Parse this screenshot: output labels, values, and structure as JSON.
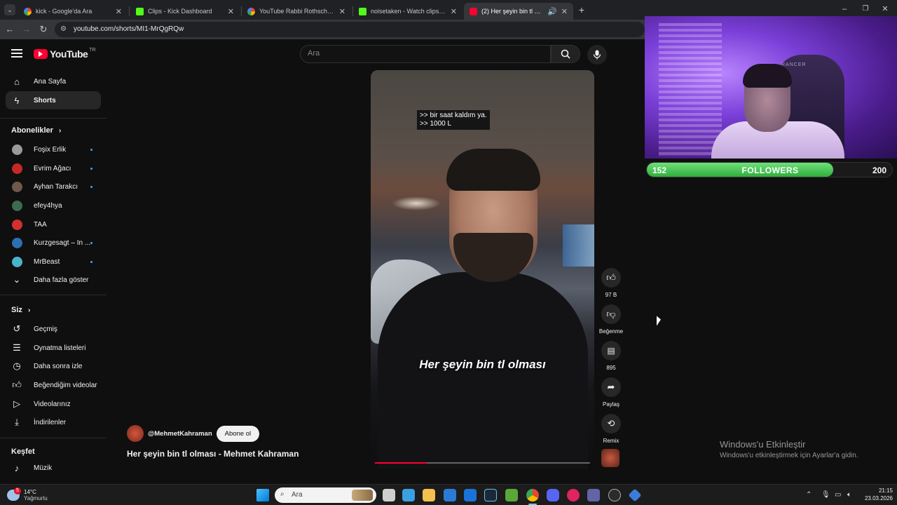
{
  "browser": {
    "tabs": [
      {
        "title": "kick - Google'da Ara",
        "icon": "google-icon",
        "color": "#ffffff"
      },
      {
        "title": "Clips - Kick Dashboard",
        "icon": "kick-icon",
        "color": "#53fc18"
      },
      {
        "title": "YouTube Rabbi Rothschild - Go",
        "icon": "google-icon",
        "color": "#ffffff"
      },
      {
        "title": "noisetaken - Watch clips on Kic",
        "icon": "kick-icon",
        "color": "#53fc18"
      },
      {
        "title": "(2) Her şeyin bin tl olması -",
        "icon": "youtube-icon",
        "color": "#ff0033"
      }
    ],
    "url": "youtube.com/shorts/MI1-MrQgRQw"
  },
  "youtube": {
    "logo_text": "YouTube",
    "logo_region": "TR",
    "search_placeholder": "Ara",
    "nav": [
      {
        "label": "Ana Sayfa",
        "icon": "home-icon"
      },
      {
        "label": "Shorts",
        "icon": "shorts-icon"
      }
    ],
    "subscriptions_heading": "Abonelikler",
    "subscriptions": [
      {
        "label": "Foşix Erlik",
        "avatar_color": "#9a9a9a",
        "new": true
      },
      {
        "label": "Evrim Ağacı",
        "avatar_color": "#c62828",
        "new": true
      },
      {
        "label": "Ayhan Tarakcı",
        "avatar_color": "#6d5a4c",
        "new": true
      },
      {
        "label": "efey4hya",
        "avatar_color": "#3d6b4f",
        "new": false
      },
      {
        "label": "TAA",
        "avatar_color": "#d32f2f",
        "new": false
      },
      {
        "label": "Kurzgesagt – In ...",
        "avatar_color": "#2c6fb3",
        "new": true
      },
      {
        "label": "MrBeast",
        "avatar_color": "#4ab3c9",
        "new": true
      }
    ],
    "show_more": "Daha fazla göster",
    "you_heading": "Siz",
    "you_items": [
      {
        "label": "Geçmiş",
        "icon": "history-icon"
      },
      {
        "label": "Oynatma listeleri",
        "icon": "playlist-icon"
      },
      {
        "label": "Daha sonra izle",
        "icon": "clock-icon"
      },
      {
        "label": "Beğendiğim videolar",
        "icon": "thumbs-up-icon"
      },
      {
        "label": "Videolarınız",
        "icon": "video-icon"
      },
      {
        "label": "İndirilenler",
        "icon": "download-icon"
      }
    ],
    "explore_heading": "Keşfet",
    "explore_items": [
      {
        "label": "Müzik",
        "icon": "music-icon"
      }
    ],
    "short": {
      "top_caption_1": ">> bir saat kaldım ya.",
      "top_caption_2": ">> 1000 L",
      "caption": "Her şeyin bin tl olması",
      "channel": "@MehmetKahraman",
      "subscribe": "Abone ol",
      "title": "Her şeyin bin tl olması - Mehmet Kahraman",
      "progress": 0.24,
      "likes": "97 B",
      "dislike_label": "Beğenme",
      "comments": "895",
      "share_label": "Paylaş",
      "remix_label": "Remix"
    }
  },
  "overlay": {
    "followers_current": "152",
    "followers_label": "FOLLOWERS",
    "followers_goal": "200",
    "followers_progress": 0.76,
    "chair_brand": "RANCER"
  },
  "windows": {
    "activate_title": "Windows'u Etkinleştir",
    "activate_sub": "Windows'u etkinleştirmek için Ayarlar'a gidin.",
    "weather_temp": "14°C",
    "weather_desc": "Yağmurlu",
    "weather_badge": "5",
    "search_placeholder": "Ara",
    "time": "21:15",
    "date": "23.03.2026"
  }
}
